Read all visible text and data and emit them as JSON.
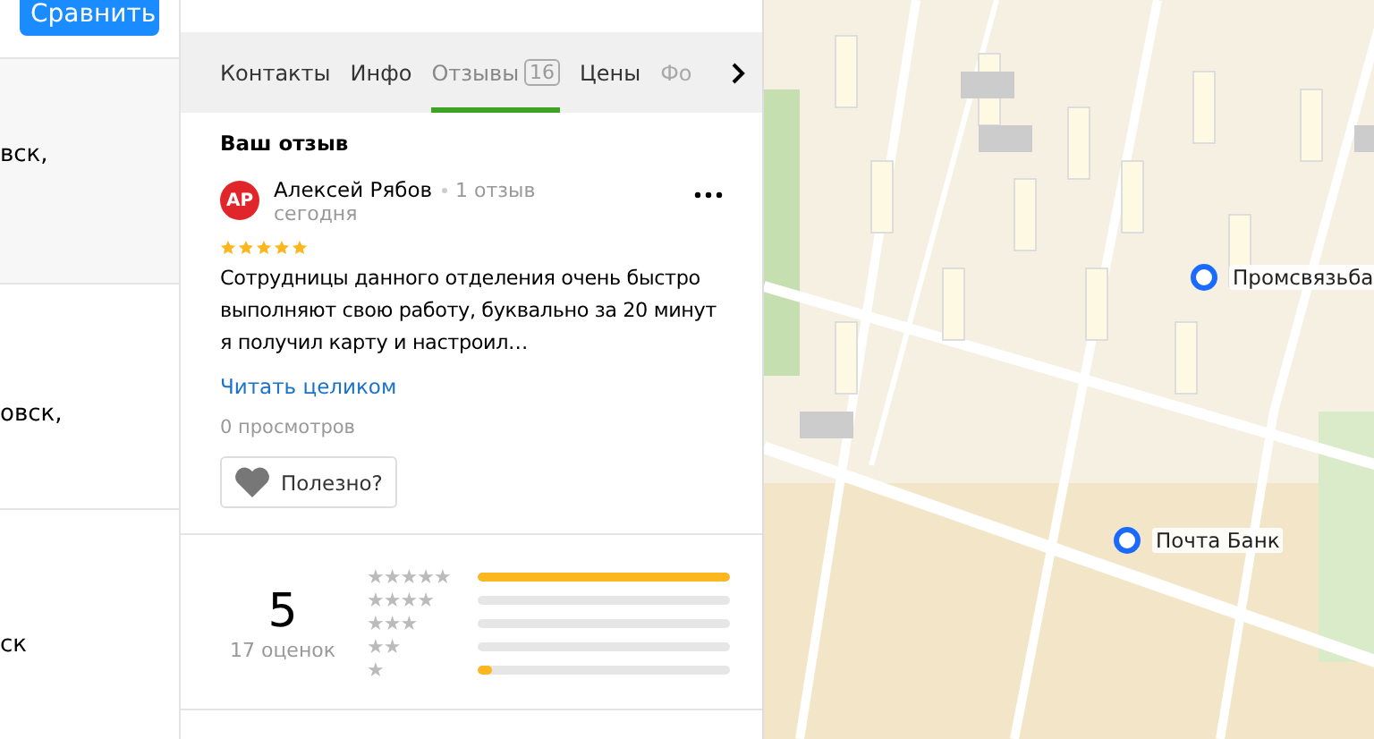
{
  "list": {
    "compare_button": "Сравнить",
    "items": [
      {
        "text": "вск,"
      },
      {
        "text": "овск,"
      },
      {
        "text": "ск"
      }
    ]
  },
  "tabs": [
    {
      "label": "Контакты",
      "selected": false,
      "faded": false
    },
    {
      "label": "Инфо",
      "selected": false,
      "faded": false
    },
    {
      "label": "Отзывы",
      "count": "16",
      "selected": true,
      "faded": false
    },
    {
      "label": "Цены",
      "selected": false,
      "faded": false
    },
    {
      "label": "Фо",
      "selected": false,
      "faded": true
    }
  ],
  "your_review": {
    "heading": "Ваш отзыв",
    "initials": "АР",
    "author": "Алексей Рябов",
    "author_reviews": "1 отзыв",
    "date": "сегодня",
    "stars": 5,
    "text": "Сотрудницы данного отделения очень быстро выполняют свою работу, буквально за 20 минут я получил карту и настроил…",
    "read_more": "Читать целиком",
    "views": "0 просмотров",
    "useful_button": "Полезно?"
  },
  "rating": {
    "score": "5",
    "count": "17 оценок",
    "bars": [
      {
        "label": "★★★★★",
        "level": 1.0
      },
      {
        "label": "★★★★",
        "level": 0
      },
      {
        "label": "★★★",
        "level": 0
      },
      {
        "label": "★★",
        "level": 0
      },
      {
        "label": "★",
        "level": 0.06
      }
    ]
  },
  "map": {
    "pins": [
      {
        "label": "Промсвязьба"
      },
      {
        "label": "Почта Банк"
      }
    ]
  }
}
